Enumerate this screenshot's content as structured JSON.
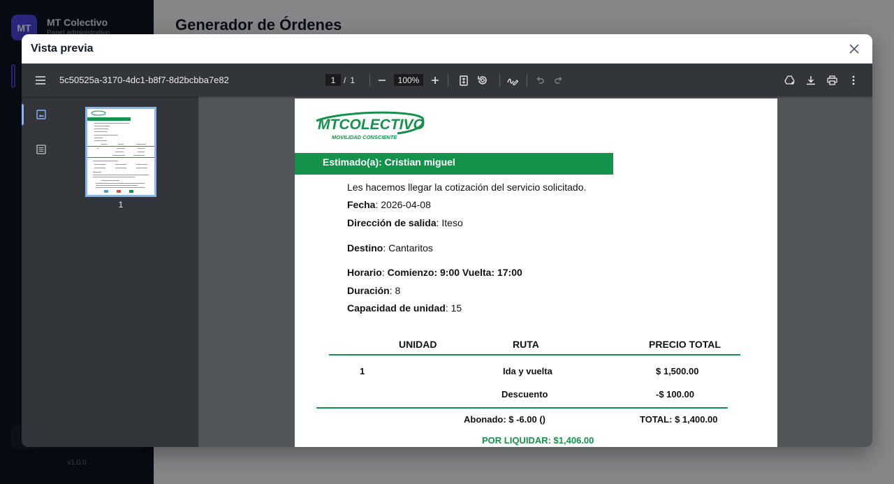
{
  "background": {
    "avatar_initials": "MT",
    "brand": "MT Colectivo",
    "brand_sub": "Panel administrativo",
    "version": "v1.0.0",
    "page_title": "Generador de Órdenes"
  },
  "modal": {
    "title": "Vista previa"
  },
  "viewer": {
    "file_name": "5c50525a-3170-4dc1-b8f7-8d2bcbba7e82",
    "current_page": "1",
    "page_sep": "/",
    "total_pages": "1",
    "zoom": "100%",
    "thumbnail_number": "1"
  },
  "document": {
    "logo_text": "MTCOLECTIVO",
    "logo_tagline": "MOVILIDAD CONSCIENTE",
    "greeting": "Estimado(a):  Cristian miguel",
    "intro": "Les hacemos llegar la cotización del servicio solicitado.",
    "fecha_label": "Fecha",
    "fecha_value": ": 2026-04-08",
    "salida_label": "Dirección de salida",
    "salida_value": ": Iteso",
    "destino_label": "Destino",
    "destino_value": ": Cantaritos",
    "horario_label": "Horario",
    "horario_value": ": ",
    "horario_detail": "Comienzo: 9:00 Vuelta: 17:00",
    "duracion_label": "Duración",
    "duracion_value": ": 8",
    "capacidad_label": "Capacidad de unidad",
    "capacidad_value": ": 15",
    "table_headers": [
      "UNIDAD",
      "RUTA",
      "PRECIO TOTAL"
    ],
    "row_unit": "1",
    "row_route": "Ida y vuelta",
    "row_price": "$ 1,500.00",
    "discount_label": "Descuento",
    "discount_value": "-$ 100.00",
    "abonado": "Abonado: $ -6.00 ()",
    "total": "TOTAL: $ 1,400.00",
    "por_liquidar": "POR LIQUIDAR: $1,406.00"
  },
  "colors": {
    "brand_green": "#14914a",
    "viewer_bg": "#323639",
    "accent_blue": "#8ab4f8"
  }
}
